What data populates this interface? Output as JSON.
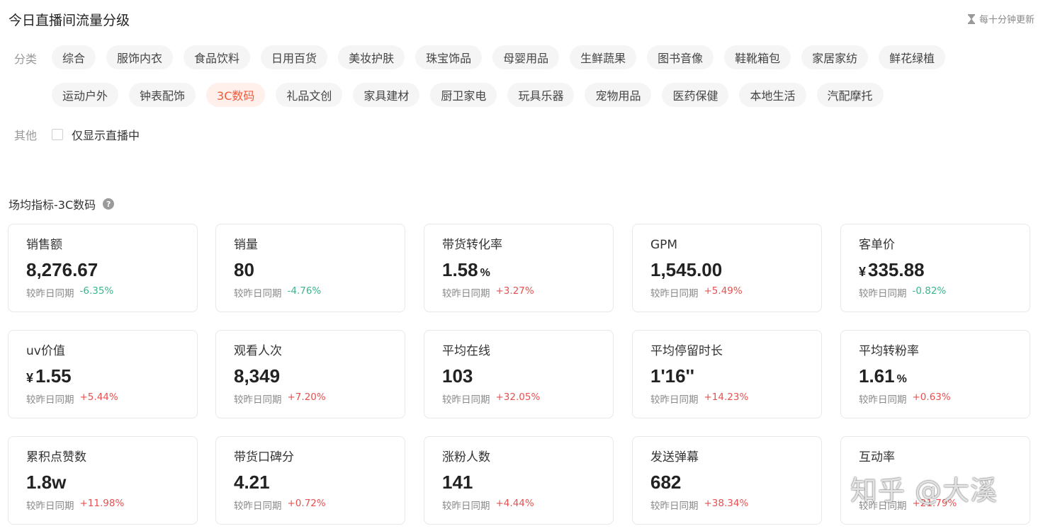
{
  "header": {
    "title": "今日直播间流量分级",
    "update_hint": "每十分钟更新",
    "update_icon": "hourglass-icon"
  },
  "filters": {
    "category_label": "分类",
    "categories_row1": [
      "综合",
      "服饰内衣",
      "食品饮料",
      "日用百货",
      "美妆护肤",
      "珠宝饰品",
      "母婴用品",
      "生鲜蔬果",
      "图书音像",
      "鞋靴箱包",
      "家居家纺",
      "鲜花绿植"
    ],
    "categories_row2": [
      "运动户外",
      "钟表配饰",
      "3C数码",
      "礼品文创",
      "家具建材",
      "厨卫家电",
      "玩具乐器",
      "宠物用品",
      "医药保健",
      "本地生活",
      "汽配摩托"
    ],
    "selected_category": "3C数码",
    "selected_color": "#f05a3b",
    "other_label": "其他",
    "live_only_label": "仅显示直播中",
    "live_only_checked": false
  },
  "metrics_section": {
    "title": "场均指标-3C数码",
    "help_icon": "question-circle-icon",
    "compare_label": "较昨日同期",
    "up_color": "#e85050",
    "down_color": "#3ab68a",
    "cards": [
      {
        "label": "销售额",
        "value": "8,276.67",
        "prefix": "",
        "suffix": "",
        "delta": "-6.35%",
        "trend": "down"
      },
      {
        "label": "销量",
        "value": "80",
        "prefix": "",
        "suffix": "",
        "delta": "-4.76%",
        "trend": "down"
      },
      {
        "label": "带货转化率",
        "value": "1.58",
        "prefix": "",
        "suffix": "%",
        "delta": "+3.27%",
        "trend": "up"
      },
      {
        "label": "GPM",
        "value": "1,545.00",
        "prefix": "",
        "suffix": "",
        "delta": "+5.49%",
        "trend": "up"
      },
      {
        "label": "客单价",
        "value": "335.88",
        "prefix": "¥",
        "suffix": "",
        "delta": "-0.82%",
        "trend": "down"
      },
      {
        "label": "uv价值",
        "value": "1.55",
        "prefix": "¥",
        "suffix": "",
        "delta": "+5.44%",
        "trend": "up"
      },
      {
        "label": "观看人次",
        "value": "8,349",
        "prefix": "",
        "suffix": "",
        "delta": "+7.20%",
        "trend": "up"
      },
      {
        "label": "平均在线",
        "value": "103",
        "prefix": "",
        "suffix": "",
        "delta": "+32.05%",
        "trend": "up"
      },
      {
        "label": "平均停留时长",
        "value": "1'16''",
        "prefix": "",
        "suffix": "",
        "delta": "+14.23%",
        "trend": "up"
      },
      {
        "label": "平均转粉率",
        "value": "1.61",
        "prefix": "",
        "suffix": "%",
        "delta": "+0.63%",
        "trend": "up"
      },
      {
        "label": "累积点赞数",
        "value": "1.8w",
        "prefix": "",
        "suffix": "",
        "delta": "+11.98%",
        "trend": "up"
      },
      {
        "label": "带货口碑分",
        "value": "4.21",
        "prefix": "",
        "suffix": "",
        "delta": "+0.72%",
        "trend": "up"
      },
      {
        "label": "涨粉人数",
        "value": "141",
        "prefix": "",
        "suffix": "",
        "delta": "+4.44%",
        "trend": "up"
      },
      {
        "label": "发送弹幕",
        "value": "682",
        "prefix": "",
        "suffix": "",
        "delta": "+38.34%",
        "trend": "up"
      },
      {
        "label": "互动率",
        "value": "",
        "prefix": "",
        "suffix": "",
        "delta": "+21.79%",
        "trend": "up"
      }
    ]
  },
  "watermark": "知乎 @大溪"
}
